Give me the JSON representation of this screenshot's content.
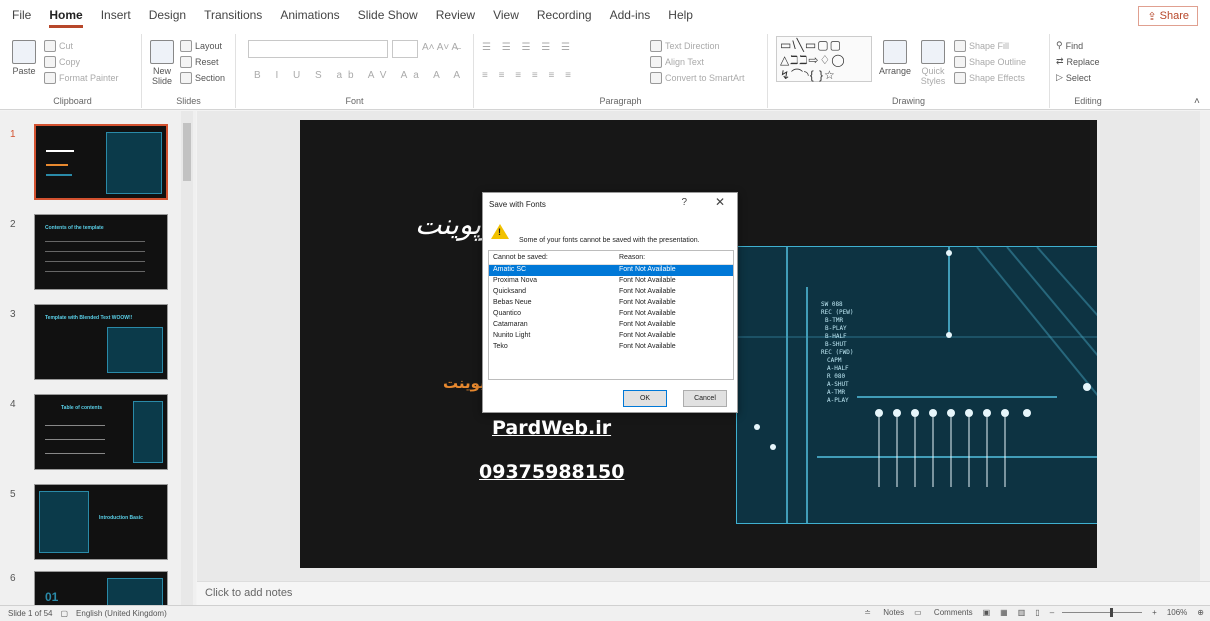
{
  "menu": {
    "tabs": [
      "File",
      "Home",
      "Insert",
      "Design",
      "Transitions",
      "Animations",
      "Slide Show",
      "Review",
      "View",
      "Recording",
      "Add-ins",
      "Help"
    ],
    "active_tab": "Home",
    "share_label": "Share"
  },
  "ribbon": {
    "clipboard": {
      "label": "Clipboard",
      "paste": "Paste",
      "cut": "Cut",
      "copy": "Copy",
      "format_painter": "Format Painter"
    },
    "slides": {
      "label": "Slides",
      "new_slide": "New Slide",
      "layout": "Layout",
      "reset": "Reset",
      "section": "Section"
    },
    "font": {
      "label": "Font"
    },
    "paragraph": {
      "label": "Paragraph",
      "text_direction": "Text Direction",
      "align_text": "Align Text",
      "convert_smartart": "Convert to SmartArt"
    },
    "drawing": {
      "label": "Drawing",
      "arrange": "Arrange",
      "quick_styles": "Quick Styles",
      "shape_fill": "Shape Fill",
      "shape_outline": "Shape Outline",
      "shape_effects": "Shape Effects",
      "shapes_preview": "▭\\╲▭▢▢ △ℶℶ⇨♢◯ ↯⌒◝{ }☆"
    },
    "editing": {
      "label": "Editing",
      "find": "Find",
      "replace": "Replace",
      "select": "Select"
    }
  },
  "thumbnails": [
    {
      "num": "1",
      "title": ""
    },
    {
      "num": "2",
      "title": "Contents of the template"
    },
    {
      "num": "3",
      "title": "Template with Blended Text  WOOW!!"
    },
    {
      "num": "4",
      "title": "Table of contents"
    },
    {
      "num": "5",
      "title": "Introduction Basic"
    },
    {
      "num": "6",
      "title": "01"
    }
  ],
  "slide": {
    "arabic_title": "پارس وب پاورپوینت",
    "orange_text": "پاورپوینت",
    "url": "PardWeb.ir",
    "phone": "09375988150",
    "circuit_labels": [
      "SW 088",
      "REC (PEW)",
      "B-TMR",
      "B-PLAY",
      "B-HALF",
      "B-SHUT",
      "REC (FWD)",
      "CAPM",
      "A-HALF",
      "R 080",
      "A-SHUT",
      "A-TMR",
      "A-PLAY"
    ]
  },
  "dialog": {
    "title": "Save with Fonts",
    "help": "?",
    "close": "✕",
    "message": "Some of your fonts cannot be saved with the presentation.",
    "col_font": "Cannot be saved:",
    "col_reason": "Reason:",
    "rows": [
      {
        "font": "Amatic SC",
        "reason": "Font Not Available"
      },
      {
        "font": "Proxima Nova",
        "reason": "Font Not Available"
      },
      {
        "font": "Quicksand",
        "reason": "Font Not Available"
      },
      {
        "font": "Bebas Neue",
        "reason": "Font Not Available"
      },
      {
        "font": "Quantico",
        "reason": "Font Not Available"
      },
      {
        "font": "Catamaran",
        "reason": "Font Not Available"
      },
      {
        "font": "Nunito Light",
        "reason": "Font Not Available"
      },
      {
        "font": "Teko",
        "reason": "Font Not Available"
      }
    ],
    "ok": "OK",
    "cancel": "Cancel"
  },
  "notes_placeholder": "Click to add notes",
  "status": {
    "slide_count": "Slide 1 of 54",
    "language": "English (United Kingdom)",
    "notes": "Notes",
    "comments": "Comments",
    "zoom": "106%",
    "zoom_level": 0.6
  },
  "colors": {
    "accent": "#b7472a",
    "selection": "#0078d7",
    "slide_bg": "#171717",
    "warning": "#f2c200"
  }
}
